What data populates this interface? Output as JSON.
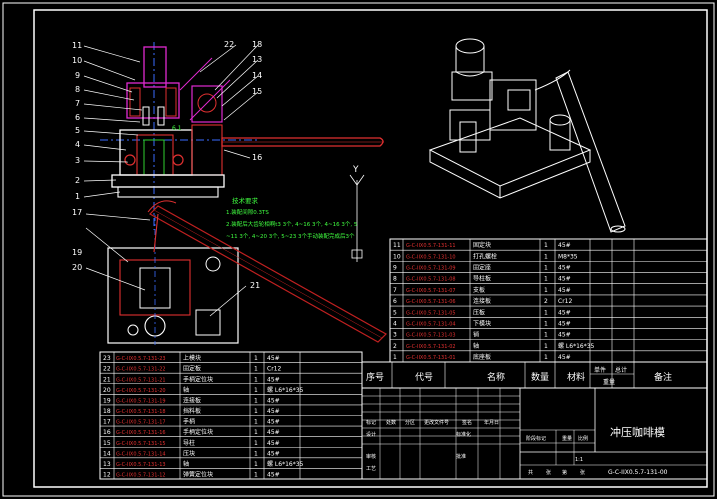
{
  "callouts_left": [
    "11",
    "10",
    "9",
    "8",
    "7",
    "6",
    "5",
    "4",
    "3",
    "2",
    "1"
  ],
  "callouts_right": [
    "22",
    "18",
    "13",
    "14",
    "15",
    "16"
  ],
  "callouts_lower": [
    "17",
    "19",
    "20",
    "21"
  ],
  "tech_title": "技术要求",
  "tech_lines": [
    "1.装配间隙0.3TS",
    "2.装配后大齿轮相啊t3 3个, 4~16 3个, 4~16 3个, 5",
    "~11 3个, 4~20 3个, 5~23 3个手动装配完成后3个"
  ],
  "dim_label": "6.1",
  "axis_label": "Y",
  "bom_header": [
    "序号",
    "代号",
    "名称",
    "数量",
    "材料",
    "单件",
    "总计",
    "备注"
  ],
  "bom_header_sub": "重量",
  "bom_top": [
    {
      "no": "11",
      "code": "G-C-IIX0.5.7-131-11",
      "name": "固定块",
      "qty": "1",
      "mat": "45#"
    },
    {
      "no": "10",
      "code": "G-C-IIX0.5.7-131-10",
      "name": "打孔螺栓",
      "qty": "1",
      "mat": "M8*35"
    },
    {
      "no": "9",
      "code": "G-C-IIX0.5.7-131-09",
      "name": "固定座",
      "qty": "1",
      "mat": "45#"
    },
    {
      "no": "8",
      "code": "G-C-IIX0.5.7-131-08",
      "name": "导柱板",
      "qty": "1",
      "mat": "45#"
    },
    {
      "no": "7",
      "code": "G-C-IIX0.5.7-131-07",
      "name": "支板",
      "qty": "1",
      "mat": "45#"
    },
    {
      "no": "6",
      "code": "G-C-IIX0.5.7-131-06",
      "name": "连接板",
      "qty": "2",
      "mat": "Cr12"
    },
    {
      "no": "5",
      "code": "G-C-IIX0.5.7-131-05",
      "name": "压板",
      "qty": "1",
      "mat": "45#"
    },
    {
      "no": "4",
      "code": "G-C-IIX0.5.7-131-04",
      "name": "下模块",
      "qty": "1",
      "mat": "45#"
    },
    {
      "no": "3",
      "code": "G-C-IIX0.5.7-131-03",
      "name": "销",
      "qty": "1",
      "mat": "45#"
    },
    {
      "no": "2",
      "code": "G-C-IIX0.5.7-131-02",
      "name": "轴",
      "qty": "1",
      "mat": "螺 L6*16*35"
    },
    {
      "no": "1",
      "code": "G-C-IIX0.5.7-131-01",
      "name": "底座板",
      "qty": "1",
      "mat": "45#"
    }
  ],
  "bom_bottom": [
    {
      "no": "23",
      "code": "G-C-IIX0.5.7-131-23",
      "name": "上模块",
      "qty": "1",
      "mat": "45#"
    },
    {
      "no": "22",
      "code": "G-C-IIX0.5.7-131-22",
      "name": "固定板",
      "qty": "1",
      "mat": "Cr12"
    },
    {
      "no": "21",
      "code": "G-C-IIX0.5.7-131-21",
      "name": "手柄定位块",
      "qty": "1",
      "mat": "45#"
    },
    {
      "no": "20",
      "code": "G-C-IIX0.5.7-131-20",
      "name": "轴",
      "qty": "1",
      "mat": "螺 L6*16*35"
    },
    {
      "no": "19",
      "code": "G-C-IIX0.5.7-131-19",
      "name": "连接板",
      "qty": "1",
      "mat": "45#"
    },
    {
      "no": "18",
      "code": "G-C-IIX0.5.7-131-18",
      "name": "挡料板",
      "qty": "1",
      "mat": "45#"
    },
    {
      "no": "17",
      "code": "G-C-IIX0.5.7-131-17",
      "name": "手柄",
      "qty": "1",
      "mat": "45#"
    },
    {
      "no": "16",
      "code": "G-C-IIX0.5.7-131-16",
      "name": "手柄定位块",
      "qty": "1",
      "mat": "45#"
    },
    {
      "no": "15",
      "code": "G-C-IIX0.5.7-131-15",
      "name": "导柱",
      "qty": "1",
      "mat": "45#"
    },
    {
      "no": "14",
      "code": "G-C-IIX0.5.7-131-14",
      "name": "压块",
      "qty": "1",
      "mat": "45#"
    },
    {
      "no": "13",
      "code": "G-C-IIX0.5.7-131-13",
      "name": "轴",
      "qty": "1",
      "mat": "螺 L6*16*35"
    },
    {
      "no": "12",
      "code": "G-C-IIX0.5.7-131-12",
      "name": "弹簧定位块",
      "qty": "1",
      "mat": "45#"
    }
  ],
  "title_block": {
    "drawing_title": "冲压咖啡模",
    "drawing_no": "G-C-IIX0.5.7-131-00",
    "scale": "1:1",
    "row_labels": [
      "标记",
      "处数",
      "分区",
      "更改文件号",
      "签名",
      "年月日"
    ],
    "row_labels2": [
      "设计",
      "标准化",
      "审核",
      "工艺",
      "批准"
    ],
    "stage_labels": [
      "阶段标记",
      "重量",
      "比例"
    ],
    "sheet_labels": [
      "共",
      "张",
      "第",
      "张"
    ]
  },
  "colors": {
    "frame": "#ffffff",
    "part": "#e03030",
    "aux": "#e02ad0",
    "centerline": "#3a6cff",
    "dim_text": "#40ff40",
    "handle": "#c02020"
  }
}
